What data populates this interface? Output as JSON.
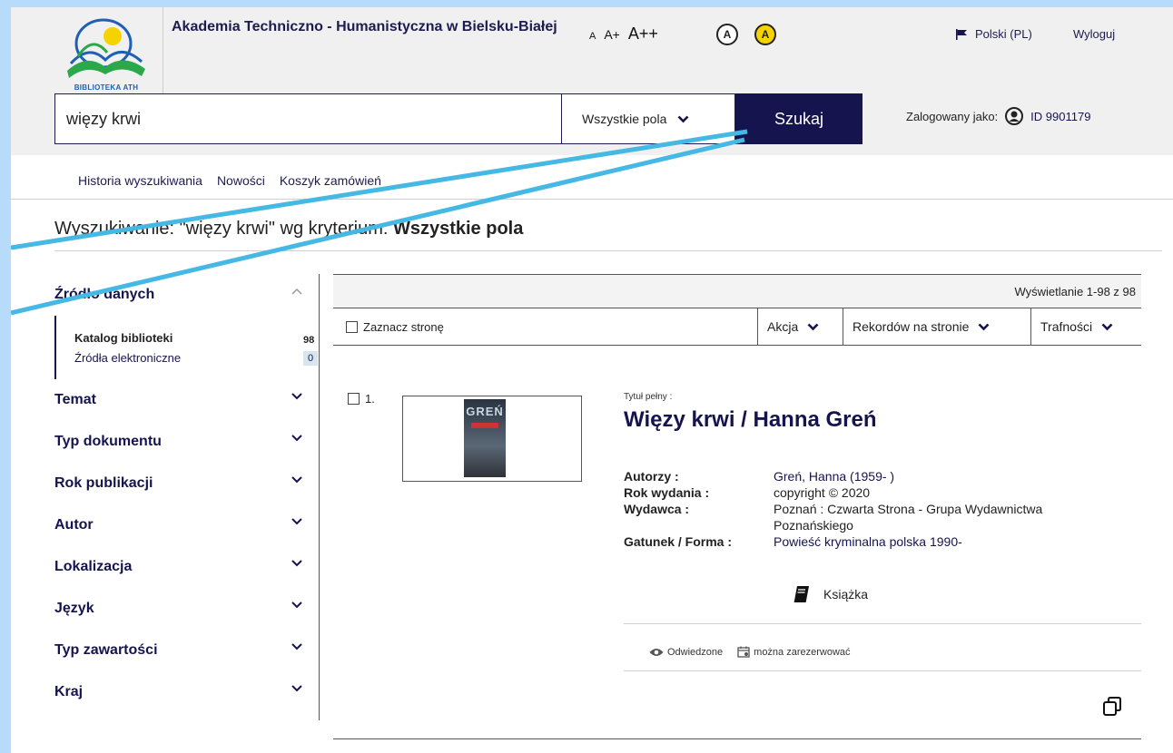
{
  "header": {
    "logo_text": "BIBLIOTEKA ATH",
    "university": "Akademia Techniczno - Humanistyczna w Bielsku-Białej",
    "font_sizes": [
      "A",
      "A+",
      "A++"
    ],
    "contrast_labels": [
      "A",
      "A"
    ],
    "language": "Polski (PL)",
    "logout": "Wyloguj",
    "logged_in_label": "Zalogowany jako:",
    "user_id": "ID 9901179"
  },
  "search": {
    "query": "więzy krwi",
    "field": "Wszystkie pola",
    "button": "Szukaj"
  },
  "nav": {
    "items": [
      "Historia wyszukiwania",
      "Nowości",
      "Koszyk zamówień"
    ]
  },
  "results_title": {
    "prefix": "Wyszukiwanie: \"więzy krwi\" wg kryterium: ",
    "criterion": "Wszystkie pola"
  },
  "facets": {
    "source": {
      "label": "Źródło danych",
      "items": [
        {
          "label": "Katalog biblioteki",
          "count": "98"
        },
        {
          "label": "Źródła elektroniczne",
          "count": "0"
        }
      ]
    },
    "groups": [
      "Temat",
      "Typ dokumentu",
      "Rok publikacji",
      "Autor",
      "Lokalizacja",
      "Język",
      "Typ zawartości",
      "Kraj"
    ]
  },
  "results": {
    "display": "Wyświetlanie 1-98 z 98",
    "select_page": "Zaznacz stronę",
    "action": "Akcja",
    "per_page": "Rekordów na stronie",
    "sort": "Trafności"
  },
  "record": {
    "number": "1.",
    "title_label": "Tytuł pełny :",
    "title": "Więzy krwi / Hanna Greń",
    "cover_text": "GREŃ",
    "authors_label": "Autorzy :",
    "authors": "Greń, Hanna (1959- )",
    "year_label": "Rok wydania :",
    "year": "copyright © 2020",
    "publisher_label": "Wydawca :",
    "publisher": "Poznań : Czwarta Strona - Grupa Wydawnictwa Poznańskiego",
    "genre_label": "Gatunek / Forma :",
    "genre": "Powieść kryminalna polska 1990-",
    "type": "Książka",
    "visited": "Odwiedzone",
    "reservable": "można zarezerwować"
  }
}
